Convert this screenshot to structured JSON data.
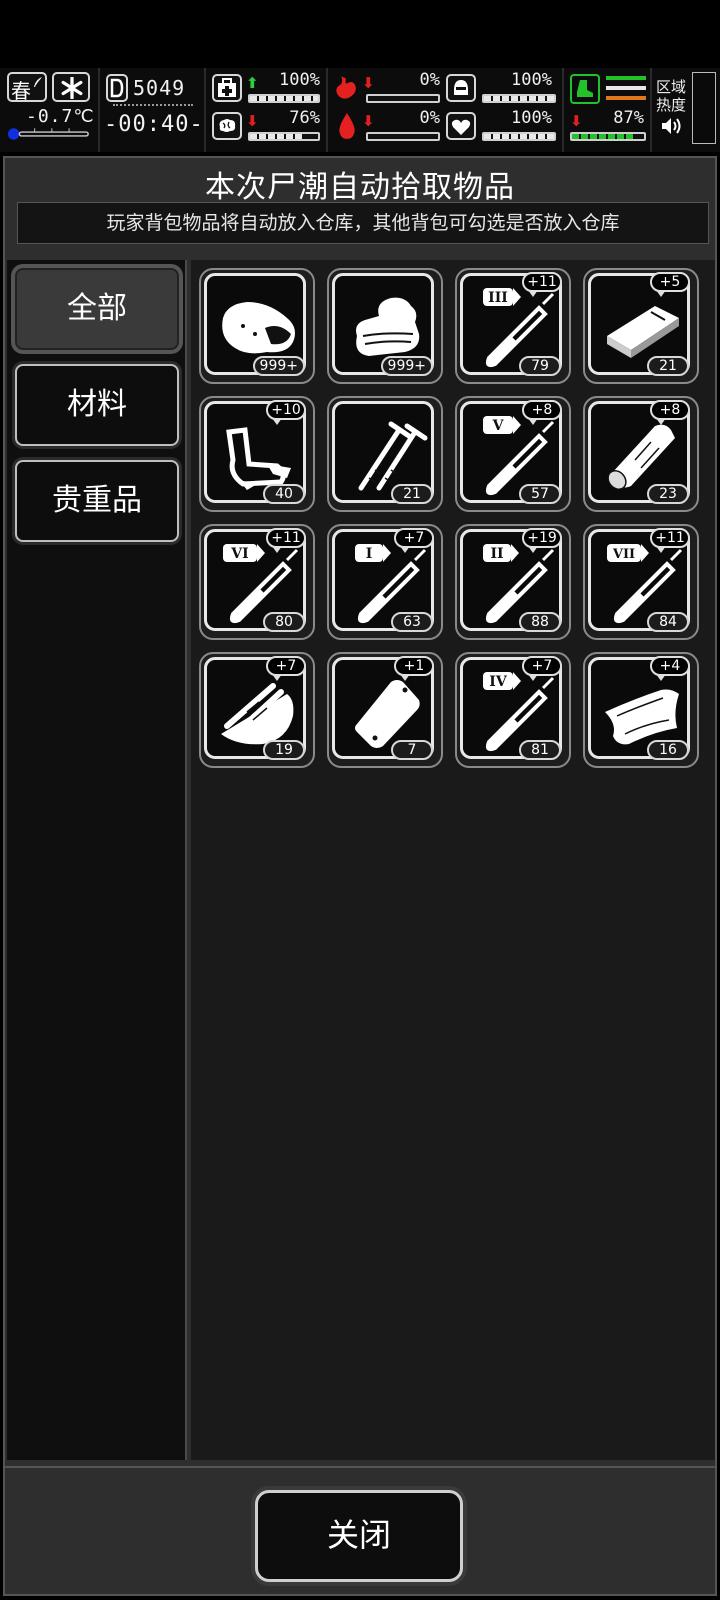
{
  "hud": {
    "season": "春",
    "temperature": "-0.7℃",
    "day": "5049",
    "time": "-00:40-",
    "stats": {
      "health": {
        "value": "100%",
        "fill": 1.0,
        "trend": "up"
      },
      "hunger": {
        "value": "0%",
        "fill": 0.0,
        "trend": "down"
      },
      "armor": {
        "value": "100%",
        "fill": 1.0,
        "trend": "none"
      },
      "stamina": {
        "value": "76%",
        "fill": 0.76,
        "trend": "down"
      },
      "blood": {
        "value": "0%",
        "fill": 0.0,
        "trend": "down"
      },
      "mood": {
        "value": "100%",
        "fill": 1.0,
        "trend": "none"
      },
      "speed": {
        "value": "87%",
        "fill": 0.87,
        "trend": "down"
      }
    },
    "zone_heat_label": "区域热度",
    "colors": {
      "up": "#2ecc40",
      "down": "#e02020",
      "green": "#22c22a",
      "orange": "#e07820"
    }
  },
  "dialog": {
    "title": "本次尸潮自动拾取物品",
    "subtitle": "玩家背包物品将自动放入仓库，其他背包可勾选是否放入仓库",
    "tabs": [
      {
        "label": "全部",
        "active": true
      },
      {
        "label": "材料",
        "active": false
      },
      {
        "label": "贵重品",
        "active": false
      }
    ],
    "items": [
      {
        "icon": "meat-icon",
        "count": "999+",
        "bonus": ""
      },
      {
        "icon": "cloth-icon",
        "count": "999+",
        "bonus": ""
      },
      {
        "icon": "serum-iii-icon",
        "tier": "III",
        "count": "79",
        "bonus": "+11"
      },
      {
        "icon": "board-icon",
        "count": "21",
        "bonus": "+5"
      },
      {
        "icon": "scrap-metal-icon",
        "count": "40",
        "bonus": "+10"
      },
      {
        "icon": "nails-icon",
        "count": "21",
        "bonus": ""
      },
      {
        "icon": "serum-v-icon",
        "tier": "V",
        "count": "57",
        "bonus": "+8"
      },
      {
        "icon": "wood-log-icon",
        "count": "23",
        "bonus": "+8"
      },
      {
        "icon": "serum-vi-icon",
        "tier": "VI",
        "count": "80",
        "bonus": "+11"
      },
      {
        "icon": "serum-i-icon",
        "tier": "I",
        "count": "63",
        "bonus": "+7"
      },
      {
        "icon": "serum-ii-icon",
        "tier": "II",
        "count": "88",
        "bonus": "+19"
      },
      {
        "icon": "serum-vii-icon",
        "tier": "VII",
        "count": "84",
        "bonus": "+11"
      },
      {
        "icon": "planks-icon",
        "count": "19",
        "bonus": "+7"
      },
      {
        "icon": "plastic-bag-icon",
        "count": "7",
        "bonus": "+1"
      },
      {
        "icon": "serum-iv-icon",
        "tier": "IV",
        "count": "81",
        "bonus": "+7"
      },
      {
        "icon": "leather-icon",
        "count": "16",
        "bonus": "+4"
      }
    ],
    "close_label": "关闭"
  }
}
